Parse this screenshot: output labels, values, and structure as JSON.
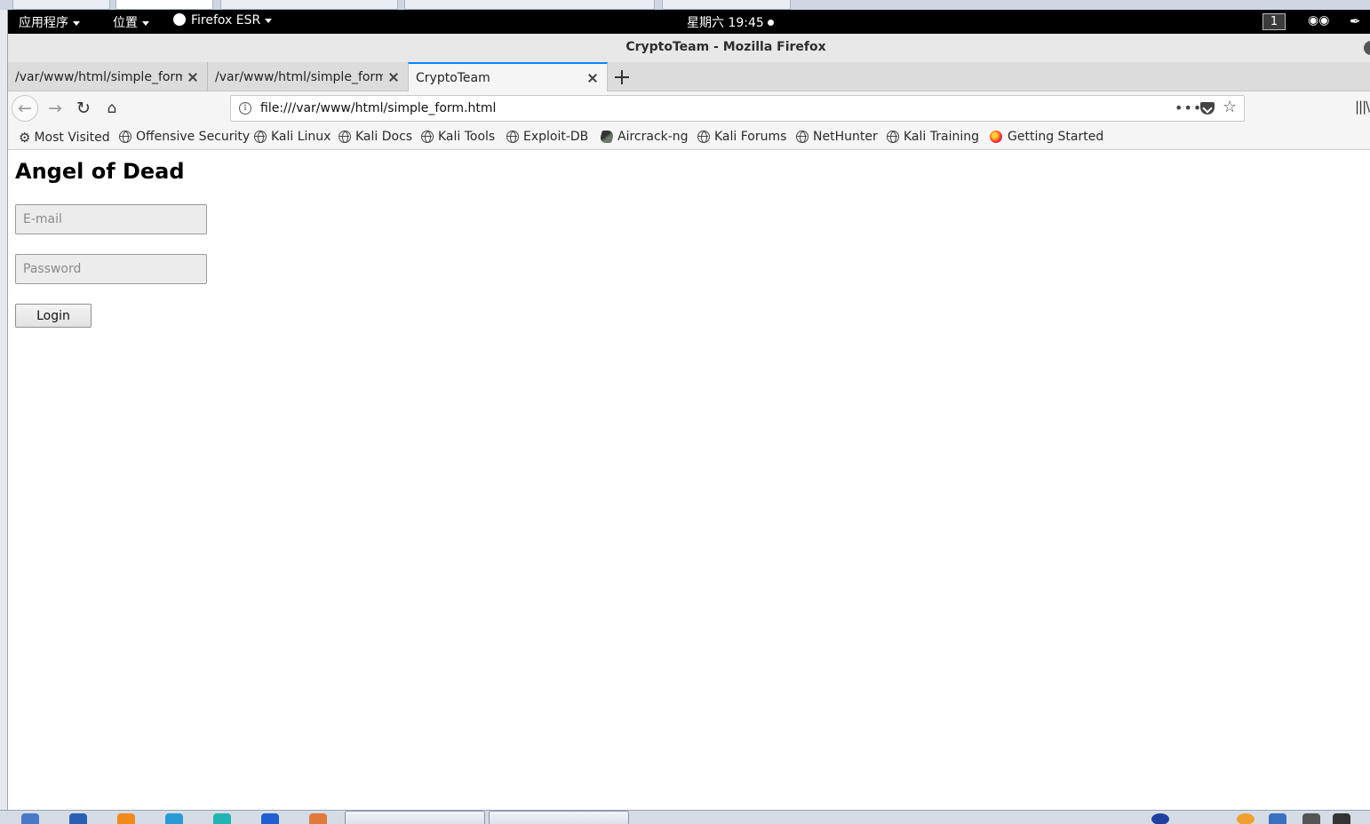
{
  "colors": {
    "topbar_bg": "#000000",
    "active_tab_accent": "#0a84ff",
    "chrome_bg": "#f5f5f5",
    "page_bg": "#ffffff"
  },
  "gnome_topbar": {
    "applications_menu": "应用程序",
    "places_menu": "位置",
    "firefox_menu": "Firefox ESR",
    "clock": "星期六 19:45",
    "workspace": "1"
  },
  "window": {
    "title": "CryptoTeam - Mozilla Firefox"
  },
  "tabs": [
    {
      "label": "/var/www/html/simple_form.html"
    },
    {
      "label": "/var/www/html/simple_form.html"
    },
    {
      "label": "CryptoTeam"
    }
  ],
  "navbar": {
    "url": "file:///var/www/html/simple_form.html",
    "page_actions": "•••"
  },
  "bookmarks": [
    {
      "label": "Most Visited",
      "icon": "gear-icon"
    },
    {
      "label": "Offensive Security",
      "icon": "globe-icon"
    },
    {
      "label": "Kali Linux",
      "icon": "globe-icon"
    },
    {
      "label": "Kali Docs",
      "icon": "globe-icon"
    },
    {
      "label": "Kali Tools",
      "icon": "globe-icon"
    },
    {
      "label": "Exploit-DB",
      "icon": "globe-icon"
    },
    {
      "label": "Aircrack-ng",
      "icon": "aircrack-icon"
    },
    {
      "label": "Kali Forums",
      "icon": "globe-icon"
    },
    {
      "label": "NetHunter",
      "icon": "globe-icon"
    },
    {
      "label": "Kali Training",
      "icon": "globe-icon"
    },
    {
      "label": "Getting Started",
      "icon": "firefox-icon"
    }
  ],
  "page": {
    "heading": "Angel of Dead",
    "email_placeholder": "E-mail",
    "email_value": "",
    "password_placeholder": "Password",
    "password_value": "",
    "login_label": "Login"
  }
}
